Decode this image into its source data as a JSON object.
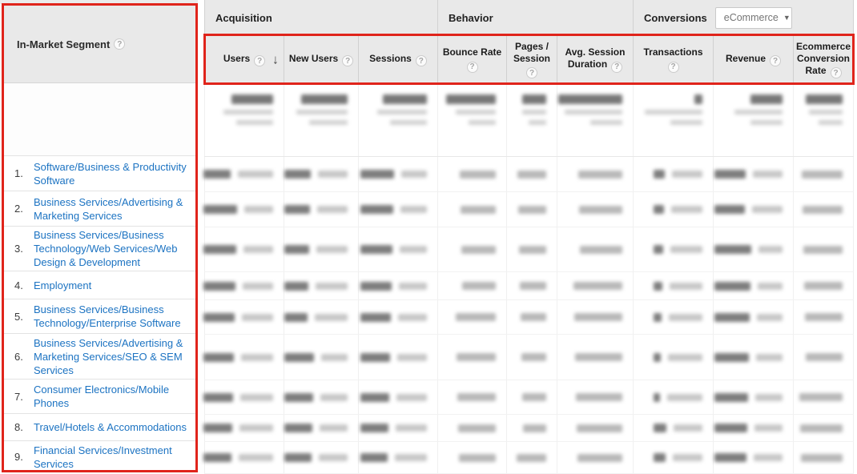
{
  "left_panel": {
    "title": "In-Market Segment",
    "rows": [
      {
        "rank": "1.",
        "label": "Software/Business & Productivity Software"
      },
      {
        "rank": "2.",
        "label": "Business Services/Advertising & Marketing Services"
      },
      {
        "rank": "3.",
        "label": "Business Services/Business Technology/Web Services/Web Design & Development"
      },
      {
        "rank": "4.",
        "label": "Employment"
      },
      {
        "rank": "5.",
        "label": "Business Services/Business Technology/Enterprise Software"
      },
      {
        "rank": "6.",
        "label": "Business Services/Advertising & Marketing Services/SEO & SEM Services"
      },
      {
        "rank": "7.",
        "label": "Consumer Electronics/Mobile Phones"
      },
      {
        "rank": "8.",
        "label": "Travel/Hotels & Accommodations"
      },
      {
        "rank": "9.",
        "label": "Financial Services/Investment Services"
      }
    ]
  },
  "table": {
    "group_headers": [
      {
        "label": "Acquisition"
      },
      {
        "label": "Behavior"
      },
      {
        "label": "Conversions",
        "dropdown_value": "eCommerce"
      }
    ],
    "columns": [
      {
        "id": "users",
        "label": "Users",
        "lines": [
          "Users"
        ],
        "icon_inline": true,
        "sorted_desc": true
      },
      {
        "id": "new-users",
        "label": "New Users",
        "lines": [
          "New Users"
        ],
        "icon_inline": true
      },
      {
        "id": "sessions",
        "label": "Sessions",
        "lines": [
          "Sessions"
        ],
        "icon_inline": true
      },
      {
        "id": "bounce-rate",
        "label": "Bounce Rate",
        "lines": [
          "Bounce Rate"
        ],
        "icon_inline": false
      },
      {
        "id": "pages-session",
        "label": "Pages / Session",
        "lines": [
          "Pages /",
          "Session"
        ],
        "icon_inline": false
      },
      {
        "id": "avg-session-duration",
        "label": "Avg. Session Duration",
        "lines": [
          "Avg. Session",
          "Duration"
        ],
        "icon_inline": true
      },
      {
        "id": "transactions",
        "label": "Transactions",
        "lines": [
          "Transactions"
        ],
        "icon_inline": false
      },
      {
        "id": "revenue",
        "label": "Revenue",
        "lines": [
          "Revenue"
        ],
        "icon_inline": true
      },
      {
        "id": "ecommerce-conversion-rate",
        "label": "Ecommerce Conversion Rate",
        "lines": [
          "Ecommerce",
          "Conversion",
          "Rate"
        ],
        "icon_inline": true
      }
    ],
    "values_blurred": true,
    "data_row_count": 9
  },
  "icons": {
    "help_glyph": "?",
    "sort_desc_glyph": "↓",
    "caret_glyph": "▼"
  },
  "colors": {
    "annotation_red": "#e0241b",
    "header_gray": "#e9e9e9",
    "link_blue": "#1c73c2"
  }
}
